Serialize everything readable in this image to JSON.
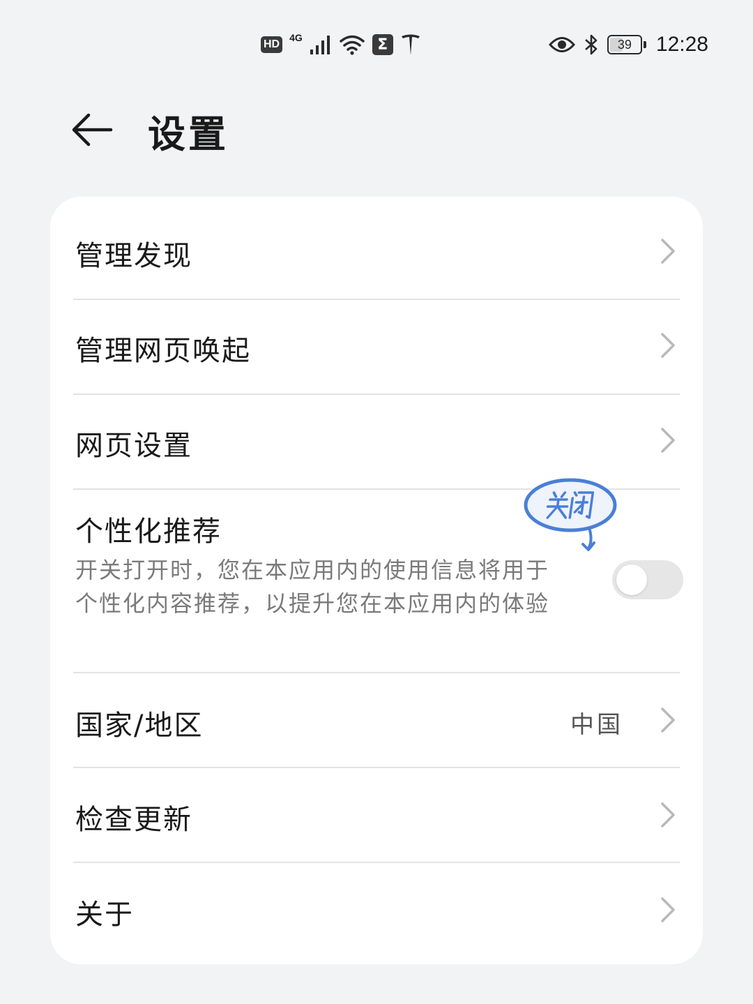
{
  "status_bar": {
    "hd": "HD",
    "net": "4G",
    "sigma": "Σ",
    "battery": "39",
    "battery_level": 0.39,
    "time": "12:28"
  },
  "header": {
    "title": "设置"
  },
  "settings": {
    "manage_discover": "管理发现",
    "manage_web_invoke": "管理网页唤起",
    "web_settings": "网页设置",
    "personalized": {
      "label": "个性化推荐",
      "desc": "开关打开时，您在本应用内的使用信息将用于个性化内容推荐，以提升您在本应用内的体验",
      "toggle_on": false
    },
    "region": {
      "label": "国家/地区",
      "value": "中国"
    },
    "check_update": "检查更新",
    "about": "关于"
  },
  "annotation": {
    "sticker_text": "关闭",
    "sticker_color": "#4a7fd6"
  },
  "colors": {
    "background": "#f1f3f5",
    "card": "#ffffff",
    "text_primary": "#1a1a1a",
    "text_secondary": "#7a7a7a",
    "chevron": "#b8b8b8",
    "toggle_off": "#e6e6e6"
  }
}
